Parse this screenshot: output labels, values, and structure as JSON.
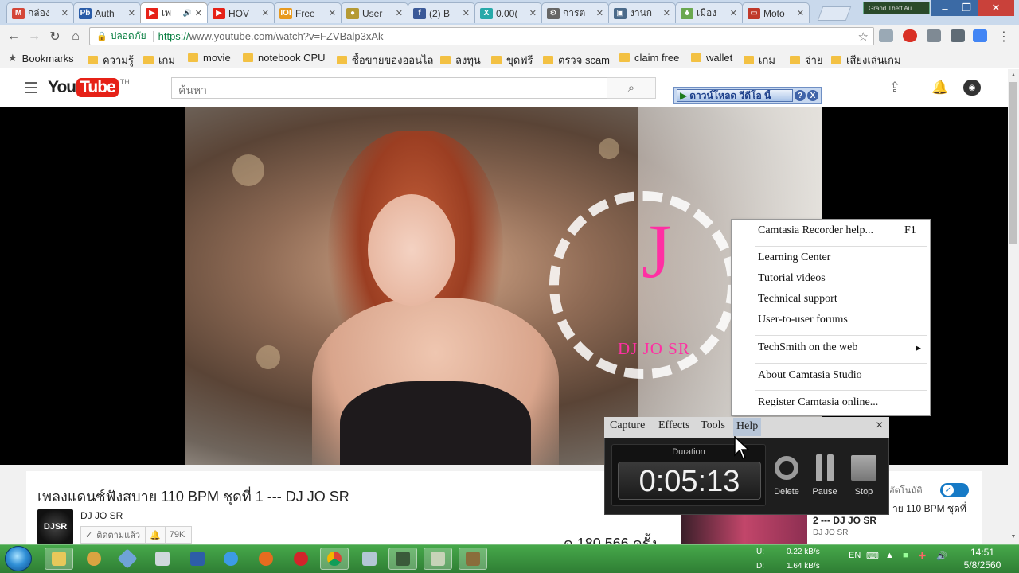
{
  "tabs": [
    {
      "label": "กล่อง",
      "icon": "gmail-icon",
      "color": "#d44638",
      "glyph": "M"
    },
    {
      "label": "Auth",
      "icon": "pb-icon",
      "color": "#2a5ca8",
      "glyph": "Pb"
    },
    {
      "label": "เพ",
      "icon": "youtube-icon",
      "color": "#e62117",
      "glyph": "▶",
      "active": true,
      "audio": "🔊"
    },
    {
      "label": "HOV",
      "icon": "youtube-icon",
      "color": "#e62117",
      "glyph": "▶"
    },
    {
      "label": "Free",
      "icon": "ioi-icon",
      "color": "#e89a1f",
      "glyph": "IOI"
    },
    {
      "label": "User",
      "icon": "coin-icon",
      "color": "#b59a34",
      "glyph": "●"
    },
    {
      "label": "(2) B",
      "icon": "facebook-icon",
      "color": "#3b5998",
      "glyph": "f"
    },
    {
      "label": "0.00(",
      "icon": "x-icon",
      "color": "#27a9a9",
      "glyph": "X"
    },
    {
      "label": "การต",
      "icon": "gear-icon",
      "color": "#666666",
      "glyph": "⚙"
    },
    {
      "label": "งานก",
      "icon": "page-icon",
      "color": "#4a6a8a",
      "glyph": "▣"
    },
    {
      "label": "เมือง",
      "icon": "leaf-icon",
      "color": "#6aa84f",
      "glyph": "♣"
    },
    {
      "label": "Moto",
      "icon": "car-icon",
      "color": "#c0392b",
      "glyph": "▭"
    }
  ],
  "window_app": "Grand Theft Au...",
  "address": {
    "secure_label": "ปลอดภัย",
    "protocol": "https://",
    "url_rest": "www.youtube.com/watch?v=FZVBalp3xAk"
  },
  "bookmarks": {
    "label": "Bookmarks",
    "items": [
      "ความรู้",
      "เกม",
      "movie",
      "notebook CPU",
      "ซื้อขายของออนไล",
      "ลงทุน",
      "ขุดฟรี",
      "ตรวจ scam",
      "claim free",
      "wallet",
      "เกม",
      "จ่าย",
      "เสียงเล่นเกม"
    ]
  },
  "youtube": {
    "logo_you": "You",
    "logo_tube": "Tube",
    "logo_region": "TH",
    "search_placeholder": "ค้นหา",
    "download_bar": "ดาวน์โหลด วีดีโอ นี้",
    "download_help": "?",
    "download_close": "X",
    "video_title": "เพลงแดนซ์ฟังสบาย 110 BPM ชุดที่ 1 --- DJ JO SR",
    "channel_name": "DJ JO SR",
    "channel_avatar_text": "DJSR",
    "subscribe_label": "ติดตามแล้ว",
    "subscriber_count": "79K",
    "views": "ด 180,566 ครั้ง",
    "autoplay_label": "อัตโนมัติ",
    "next_title_1": "าย 110 BPM ชุดที่",
    "next_title_2": "2 --- DJ JO SR",
    "next_channel": "DJ JO SR"
  },
  "video_overlay": {
    "letter": "J",
    "name": "DJ JO SR"
  },
  "help_menu": {
    "items": [
      {
        "label": "Camtasia Recorder help...",
        "shortcut": "F1"
      },
      {
        "label": "Learning Center"
      },
      {
        "label": "Tutorial videos"
      },
      {
        "label": "Technical support"
      },
      {
        "label": "User-to-user forums"
      },
      {
        "label": "TechSmith on the web",
        "submenu": true
      },
      {
        "label": "About Camtasia Studio"
      },
      {
        "label": "Register Camtasia online..."
      }
    ]
  },
  "recorder": {
    "menu": [
      "Capture",
      "Effects",
      "Tools",
      "Help"
    ],
    "minimize": "–",
    "close": "×",
    "duration_label": "Duration",
    "duration_value": "0:05:13",
    "delete_label": "Delete",
    "pause_label": "Pause",
    "stop_label": "Stop"
  },
  "taskbar": {
    "net_up_label": "U:",
    "net_up": "0.22 kB/s",
    "net_down_label": "D:",
    "net_down": "1.64 kB/s",
    "lang": "EN",
    "time": "14:51",
    "date": "5/8/2560"
  }
}
